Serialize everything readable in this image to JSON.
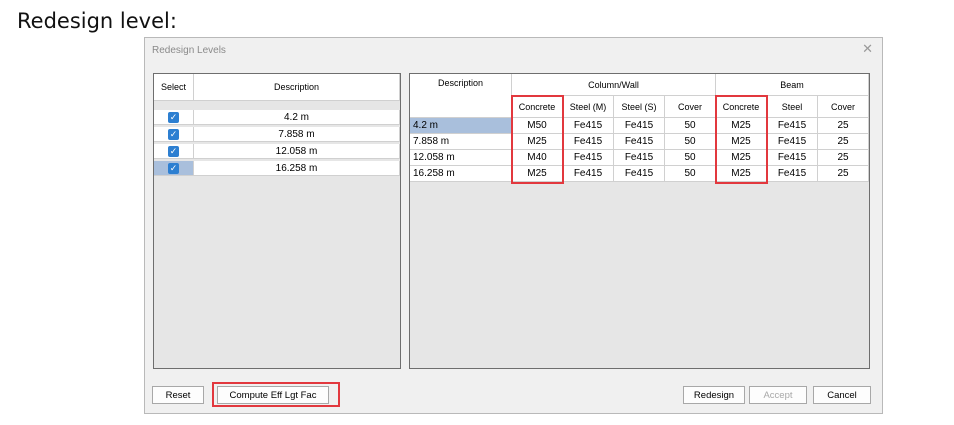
{
  "page": {
    "heading": "Redesign level:"
  },
  "dialog": {
    "title": "Redesign Levels",
    "close_glyph": "✕"
  },
  "left_table": {
    "headers": {
      "select": "Select",
      "description": "Description"
    },
    "rows": [
      {
        "checked": true,
        "description": "4.2 m"
      },
      {
        "checked": true,
        "description": "7.858 m"
      },
      {
        "checked": true,
        "description": "12.058 m"
      },
      {
        "checked": true,
        "description": "16.258 m"
      }
    ]
  },
  "right_table": {
    "headers": {
      "description": "Description",
      "group_column": "Column/Wall",
      "group_beam": "Beam",
      "sub": [
        "Concrete",
        "Steel (M)",
        "Steel (S)",
        "Cover",
        "Concrete",
        "Steel",
        "Cover"
      ]
    },
    "rows": [
      {
        "description": "4.2 m",
        "values": [
          "M50",
          "Fe415",
          "Fe415",
          "50",
          "M25",
          "Fe415",
          "25"
        ]
      },
      {
        "description": "7.858 m",
        "values": [
          "M25",
          "Fe415",
          "Fe415",
          "50",
          "M25",
          "Fe415",
          "25"
        ]
      },
      {
        "description": "12.058 m",
        "values": [
          "M40",
          "Fe415",
          "Fe415",
          "50",
          "M25",
          "Fe415",
          "25"
        ]
      },
      {
        "description": "16.258 m",
        "values": [
          "M25",
          "Fe415",
          "Fe415",
          "50",
          "M25",
          "Fe415",
          "25"
        ]
      }
    ]
  },
  "buttons": {
    "reset": "Reset",
    "compute": "Compute Eff Lgt Fac",
    "redesign": "Redesign",
    "accept": "Accept",
    "cancel": "Cancel"
  },
  "colors": {
    "highlight": "#e2383e",
    "checkbox": "#2d7fd1",
    "selected_row": "#a9bfdc"
  }
}
